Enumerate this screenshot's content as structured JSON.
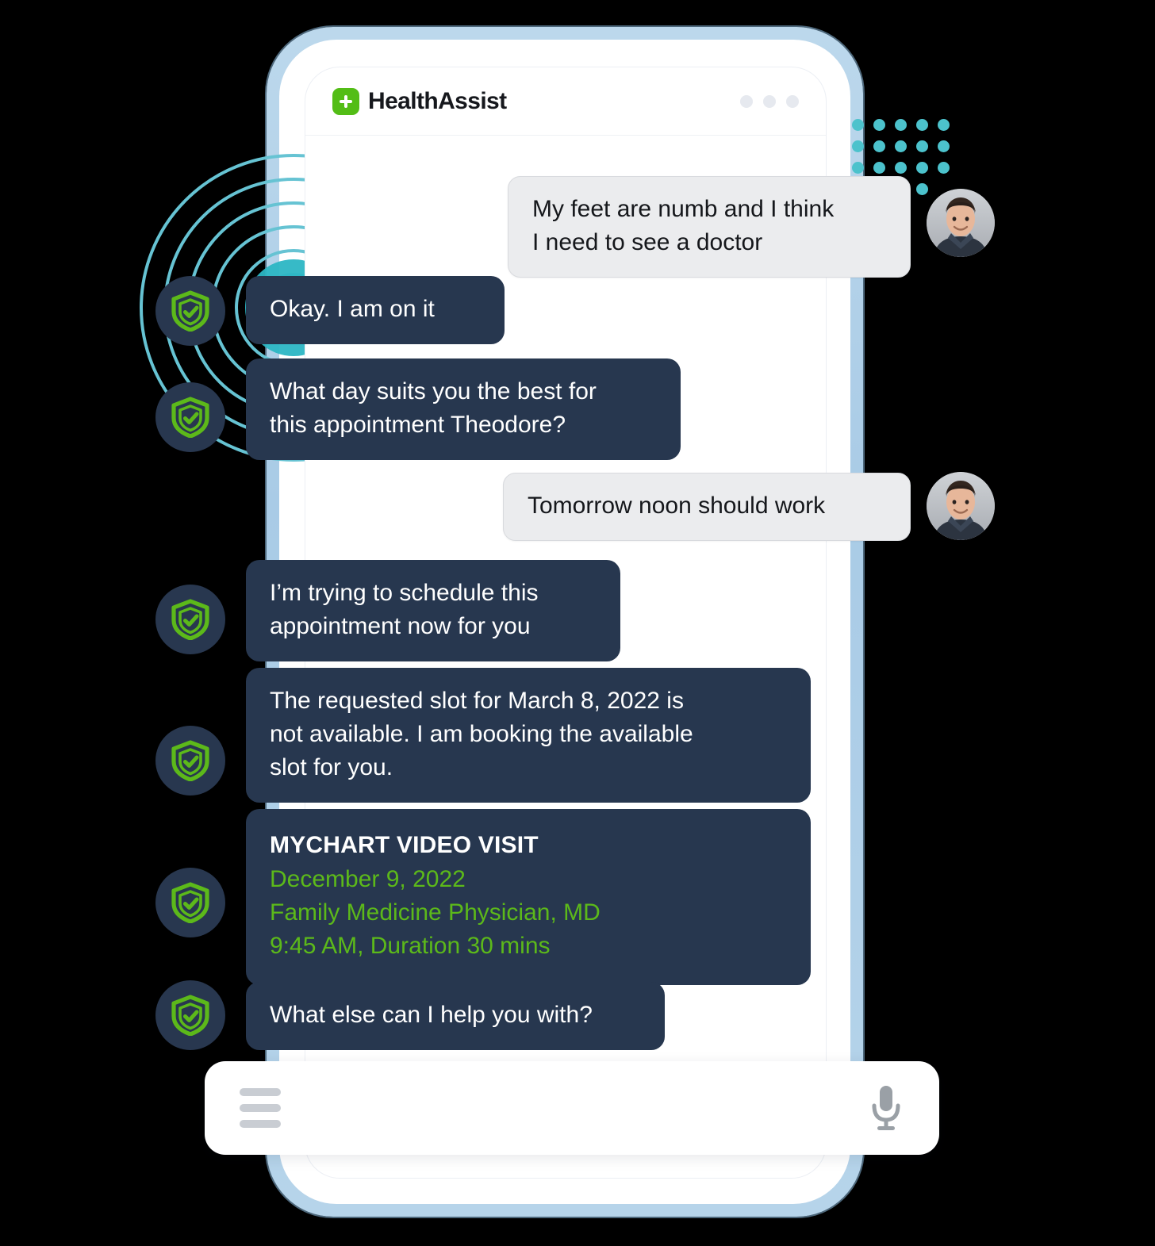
{
  "app": {
    "name": "HealthAssist",
    "logo_icon": "green-plus-badge-icon",
    "header_menu_icon": "three-dots-icon"
  },
  "conversation": [
    {
      "id": "msg-1",
      "sender": "user",
      "avatar": "user-photo-avatar",
      "lines": [
        "My feet are numb and I think",
        "I need to see a doctor"
      ]
    },
    {
      "id": "msg-2",
      "sender": "bot",
      "avatar": "shield-check-icon",
      "lines": [
        "Okay. I am on it"
      ]
    },
    {
      "id": "msg-3",
      "sender": "bot",
      "avatar": "shield-check-icon",
      "lines": [
        "What day suits you the best for",
        "this appointment Theodore?"
      ]
    },
    {
      "id": "msg-4",
      "sender": "user",
      "avatar": "user-photo-avatar",
      "lines": [
        "Tomorrow noon should work"
      ]
    },
    {
      "id": "msg-5",
      "sender": "bot",
      "avatar": "shield-check-icon",
      "lines": [
        "I’m trying to schedule this",
        "appointment now for you"
      ]
    },
    {
      "id": "msg-6",
      "sender": "bot",
      "avatar": "shield-check-icon",
      "lines": [
        "The requested slot for March 8, 2022 is",
        "not available. I am booking the available",
        "slot for you."
      ]
    },
    {
      "id": "msg-8",
      "sender": "bot",
      "avatar": "shield-check-icon",
      "lines": [
        "What else can I help you with?"
      ]
    }
  ],
  "appointment_card": {
    "id": "msg-7",
    "sender": "bot",
    "avatar": "shield-check-icon",
    "title": "MYCHART VIDEO VISIT",
    "date": "December 9, 2022",
    "provider": "Family Medicine Physician, MD",
    "time": "9:45 AM, Duration 30 mins"
  },
  "composer": {
    "menu_icon": "hamburger-menu-icon",
    "mic_icon": "microphone-icon",
    "placeholder": ""
  },
  "colors": {
    "bot_bubble": "#27374f",
    "user_bubble": "#ebecee",
    "accent_green": "#5cb91a",
    "brand_green": "#53bd16",
    "teal_dots": "#4cc2cc",
    "phone_frame": "#b6d4ea"
  }
}
